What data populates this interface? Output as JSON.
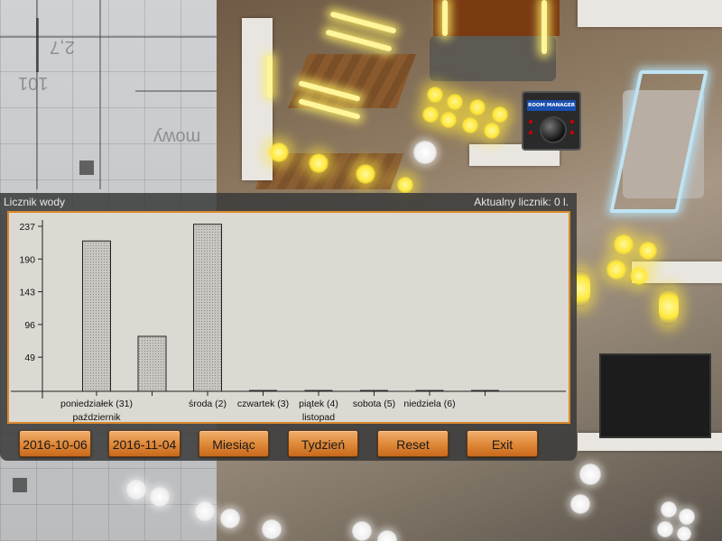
{
  "panel": {
    "title": "Licznik wody",
    "counter": "Aktualny licznik: 0 l."
  },
  "logo": {
    "text": "ROOM MANAGER"
  },
  "buttons": {
    "start_date": "2016-10-06",
    "end_date": "2016-11-04",
    "month": "Miesiąc",
    "week": "Tydzień",
    "reset": "Reset",
    "exit": "Exit"
  },
  "chart_data": {
    "type": "bar",
    "categories": [
      "poniedziałek (31)",
      "",
      "środa (2)",
      "czwartek (3)",
      "piątek (4)",
      "sobota (5)",
      "niedziela (6)",
      ""
    ],
    "values": [
      216,
      79,
      240,
      0,
      0,
      0,
      0,
      0
    ],
    "month_labels": [
      {
        "text": "październik",
        "category_index": 0
      },
      {
        "text": "listopad",
        "category_index": 4
      }
    ],
    "y_ticks": [
      49,
      96,
      143,
      190,
      237
    ],
    "ylim": [
      0,
      237
    ],
    "title": "",
    "xlabel": "",
    "ylabel": "",
    "grid": false,
    "colors": {
      "bar_fill": "#c9c6c2",
      "bar_stroke": "#222222",
      "background": "#dcd8d2",
      "border": "#d9892b"
    }
  }
}
